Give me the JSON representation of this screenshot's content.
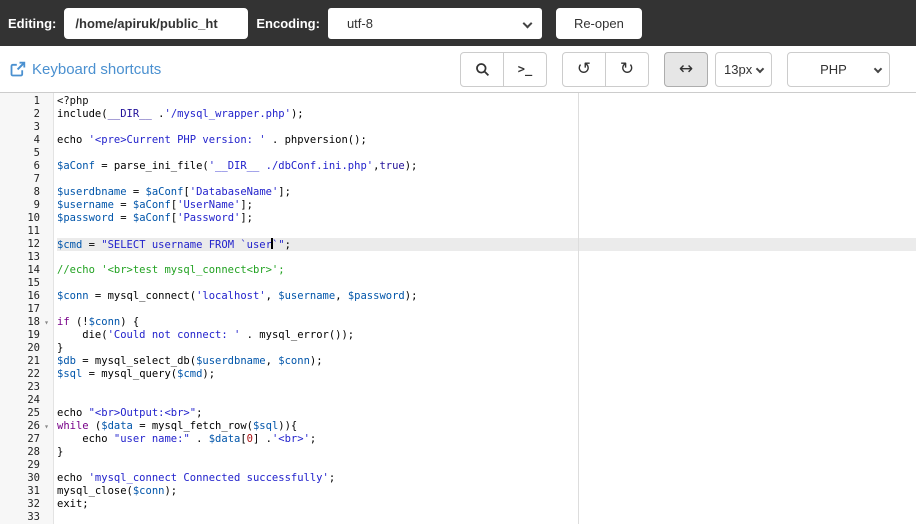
{
  "topbar": {
    "editing_label": "Editing:",
    "path_value": "/home/apiruk/public_ht",
    "encoding_label": "Encoding:",
    "encoding_value": "utf-8",
    "reopen_label": "Re-open"
  },
  "toolbar": {
    "shortcuts_label": "Keyboard shortcuts",
    "icons": {
      "terminal": ">_",
      "undo": "↺",
      "redo": "↻",
      "wrap": "↔"
    },
    "font_size_value": "13px",
    "language_value": "PHP"
  },
  "colors": {
    "topbar_bg": "#333333",
    "link_blue": "#4a90d0",
    "active_line": "#ebebeb",
    "gutter_bg": "#f7f7f7",
    "string": "#2222cc",
    "keyword": "#770088",
    "variable": "#0055aa",
    "comment": "#22a222"
  },
  "editor": {
    "lines": [
      {
        "n": 1,
        "tokens": [
          [
            "meta",
            "<?php"
          ]
        ]
      },
      {
        "n": 2,
        "tokens": [
          [
            "plain",
            "include("
          ],
          [
            "atom",
            "__DIR__"
          ],
          [
            "plain",
            " ."
          ],
          [
            "str",
            "'/mysql_wrapper.php'"
          ],
          [
            "plain",
            ");"
          ]
        ]
      },
      {
        "n": 3,
        "tokens": []
      },
      {
        "n": 4,
        "tokens": [
          [
            "plain",
            "echo "
          ],
          [
            "str",
            "'<pre>Current PHP version: '"
          ],
          [
            "plain",
            " . phpversion();"
          ]
        ]
      },
      {
        "n": 5,
        "tokens": []
      },
      {
        "n": 6,
        "tokens": [
          [
            "var",
            "$aConf"
          ],
          [
            "plain",
            " = parse_ini_file("
          ],
          [
            "str",
            "'__DIR__ ./dbConf.ini.php'"
          ],
          [
            "plain",
            ","
          ],
          [
            "atom",
            "true"
          ],
          [
            "plain",
            ");"
          ]
        ]
      },
      {
        "n": 7,
        "tokens": []
      },
      {
        "n": 8,
        "tokens": [
          [
            "var",
            "$userdbname"
          ],
          [
            "plain",
            " = "
          ],
          [
            "var",
            "$aConf"
          ],
          [
            "plain",
            "["
          ],
          [
            "str",
            "'DatabaseName'"
          ],
          [
            "plain",
            "];"
          ]
        ]
      },
      {
        "n": 9,
        "tokens": [
          [
            "var",
            "$username"
          ],
          [
            "plain",
            " = "
          ],
          [
            "var",
            "$aConf"
          ],
          [
            "plain",
            "["
          ],
          [
            "str",
            "'UserName'"
          ],
          [
            "plain",
            "];"
          ]
        ]
      },
      {
        "n": 10,
        "tokens": [
          [
            "var",
            "$password"
          ],
          [
            "plain",
            " = "
          ],
          [
            "var",
            "$aConf"
          ],
          [
            "plain",
            "["
          ],
          [
            "str",
            "'Password'"
          ],
          [
            "plain",
            "];"
          ]
        ]
      },
      {
        "n": 11,
        "tokens": []
      },
      {
        "n": 12,
        "active": true,
        "tokens": [
          [
            "var",
            "$cmd"
          ],
          [
            "plain",
            " = "
          ],
          [
            "str",
            "\"SELECT username FROM `user"
          ],
          [
            "cursor",
            ""
          ],
          [
            "str",
            "`\""
          ],
          [
            "plain",
            ";"
          ]
        ]
      },
      {
        "n": 13,
        "tokens": []
      },
      {
        "n": 14,
        "tokens": [
          [
            "cmt",
            "//echo '<br>test mysql_connect<br>';"
          ]
        ]
      },
      {
        "n": 15,
        "tokens": []
      },
      {
        "n": 16,
        "tokens": [
          [
            "var",
            "$conn"
          ],
          [
            "plain",
            " = mysql_connect("
          ],
          [
            "str",
            "'localhost'"
          ],
          [
            "plain",
            ", "
          ],
          [
            "var",
            "$username"
          ],
          [
            "plain",
            ", "
          ],
          [
            "var",
            "$password"
          ],
          [
            "plain",
            ");"
          ]
        ]
      },
      {
        "n": 17,
        "tokens": []
      },
      {
        "n": 18,
        "fold": true,
        "tokens": [
          [
            "kw",
            "if"
          ],
          [
            "plain",
            " (!"
          ],
          [
            "var",
            "$conn"
          ],
          [
            "plain",
            ") {"
          ]
        ]
      },
      {
        "n": 19,
        "tokens": [
          [
            "plain",
            "    die("
          ],
          [
            "str",
            "'Could not connect: '"
          ],
          [
            "plain",
            " . mysql_error());"
          ]
        ]
      },
      {
        "n": 20,
        "tokens": [
          [
            "plain",
            "}"
          ]
        ]
      },
      {
        "n": 21,
        "tokens": [
          [
            "var",
            "$db"
          ],
          [
            "plain",
            " = mysql_select_db("
          ],
          [
            "var",
            "$userdbname"
          ],
          [
            "plain",
            ", "
          ],
          [
            "var",
            "$conn"
          ],
          [
            "plain",
            ");"
          ]
        ]
      },
      {
        "n": 22,
        "tokens": [
          [
            "var",
            "$sql"
          ],
          [
            "plain",
            " = mysql_query("
          ],
          [
            "var",
            "$cmd"
          ],
          [
            "plain",
            ");"
          ]
        ]
      },
      {
        "n": 23,
        "tokens": []
      },
      {
        "n": 24,
        "tokens": []
      },
      {
        "n": 25,
        "tokens": [
          [
            "plain",
            "echo "
          ],
          [
            "str",
            "\"<br>Output:<br>\""
          ],
          [
            "plain",
            ";"
          ]
        ]
      },
      {
        "n": 26,
        "fold": true,
        "tokens": [
          [
            "kw",
            "while"
          ],
          [
            "plain",
            " ("
          ],
          [
            "var",
            "$data"
          ],
          [
            "plain",
            " = mysql_fetch_row("
          ],
          [
            "var",
            "$sql"
          ],
          [
            "plain",
            ")){"
          ]
        ]
      },
      {
        "n": 27,
        "tokens": [
          [
            "plain",
            "    echo "
          ],
          [
            "str",
            "\"user name:\""
          ],
          [
            "plain",
            " . "
          ],
          [
            "var",
            "$data"
          ],
          [
            "plain",
            "["
          ],
          [
            "num",
            "0"
          ],
          [
            "plain",
            "] ."
          ],
          [
            "str",
            "'<br>'"
          ],
          [
            "plain",
            ";"
          ]
        ]
      },
      {
        "n": 28,
        "tokens": [
          [
            "plain",
            "}"
          ]
        ]
      },
      {
        "n": 29,
        "tokens": []
      },
      {
        "n": 30,
        "tokens": [
          [
            "plain",
            "echo "
          ],
          [
            "str",
            "'mysql_connect Connected successfully'"
          ],
          [
            "plain",
            ";"
          ]
        ]
      },
      {
        "n": 31,
        "tokens": [
          [
            "plain",
            "mysql_close("
          ],
          [
            "var",
            "$conn"
          ],
          [
            "plain",
            ");"
          ]
        ]
      },
      {
        "n": 32,
        "tokens": [
          [
            "plain",
            "exit;"
          ]
        ]
      },
      {
        "n": 33,
        "tokens": []
      }
    ]
  }
}
